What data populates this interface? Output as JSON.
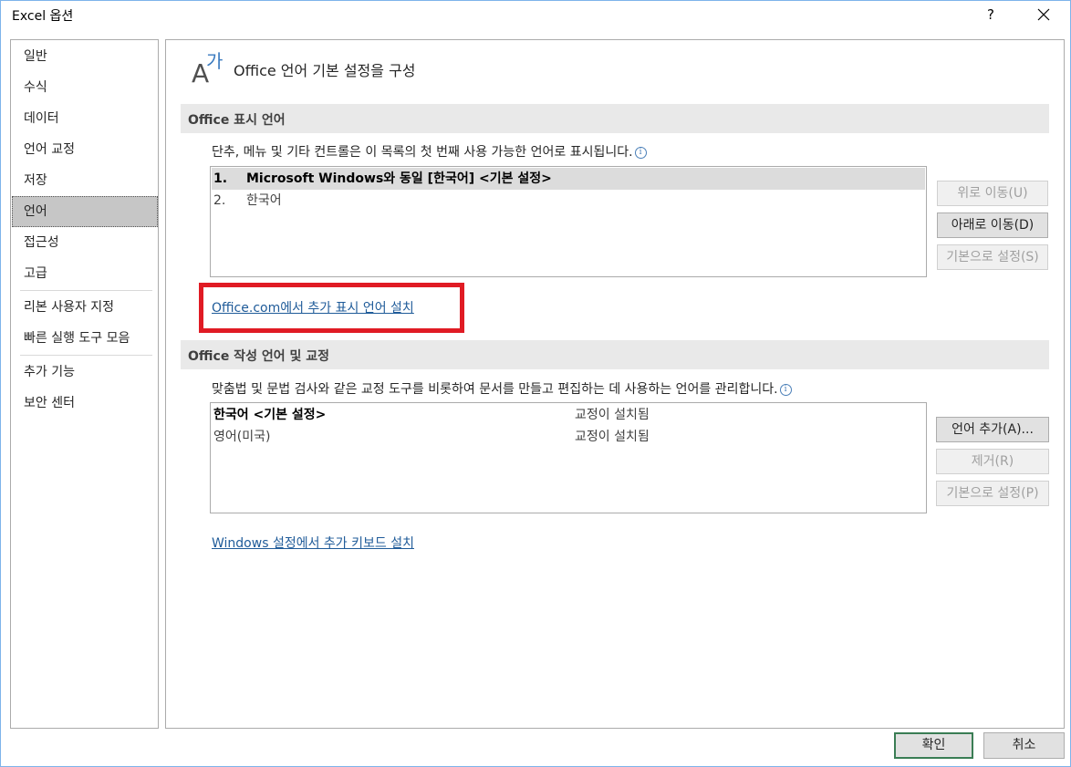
{
  "window": {
    "title": "Excel 옵션",
    "help_label": "?"
  },
  "sidebar": {
    "items": [
      {
        "label": "일반"
      },
      {
        "label": "수식"
      },
      {
        "label": "데이터"
      },
      {
        "label": "언어 교정"
      },
      {
        "label": "저장"
      },
      {
        "label": "언어",
        "selected": true
      },
      {
        "label": "접근성"
      },
      {
        "label": "고급"
      },
      {
        "label": "리본 사용자 지정"
      },
      {
        "label": "빠른 실행 도구 모음"
      },
      {
        "label": "추가 기능"
      },
      {
        "label": "보안 센터"
      }
    ]
  },
  "main": {
    "header_title": "Office 언어 기본 설정을 구성",
    "display_section": {
      "title": "Office 표시 언어",
      "description": "단추, 메뉴 및 기타 컨트롤은 이 목록의 첫 번째 사용 가능한 언어로 표시됩니다.",
      "languages": [
        {
          "num": "1.",
          "name": "Microsoft Windows와 동일 [한국어] <기본 설정>"
        },
        {
          "num": "2.",
          "name": "한국어"
        }
      ],
      "buttons": {
        "move_up": "위로 이동(U)",
        "move_down": "아래로 이동(D)",
        "set_default": "기본으로 설정(S)"
      },
      "install_link": "Office.com에서 추가 표시 언어 설치"
    },
    "authoring_section": {
      "title": "Office 작성 언어 및 교정",
      "description": "맞춤법 및 문법 검사와 같은 교정 도구를 비롯하여 문서를 만들고 편집하는 데 사용하는 언어를 관리합니다.",
      "languages": [
        {
          "name": "한국어 <기본 설정>",
          "status": "교정이 설치됨"
        },
        {
          "name": "영어(미국)",
          "status": "교정이 설치됨"
        }
      ],
      "buttons": {
        "add_language": "언어 추가(A)...",
        "remove": "제거(R)",
        "set_default": "기본으로 설정(P)"
      },
      "keyboard_link": "Windows 설정에서 추가 키보드 설치"
    }
  },
  "footer": {
    "ok_label": "확인",
    "cancel_label": "취소"
  },
  "colors": {
    "accent_link": "#1f5b99",
    "highlight_box": "#e01b24",
    "selected_nav": "#c6c6c6"
  }
}
